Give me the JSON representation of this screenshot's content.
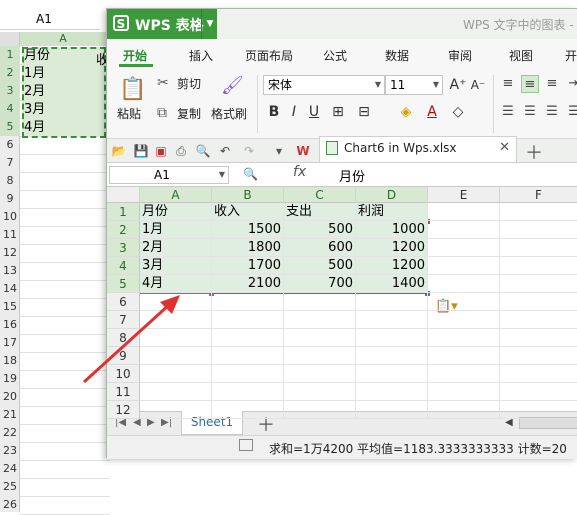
{
  "background_sheet": {
    "namebox": "A1",
    "col_header": "A",
    "row_numbers": [
      "1",
      "2",
      "3",
      "4",
      "5",
      "6",
      "7",
      "8",
      "9",
      "10",
      "11",
      "12",
      "13",
      "14",
      "15",
      "16",
      "17",
      "18",
      "19",
      "20",
      "21",
      "22",
      "23",
      "24",
      "25",
      "26"
    ],
    "cells": [
      "月份",
      "1月",
      "2月",
      "3月",
      "4月"
    ],
    "col_b_fragment": "收"
  },
  "window": {
    "app_name": "WPS 表格",
    "title": "WPS 文字中的图表 -",
    "tabs": [
      "开始",
      "插入",
      "页面布局",
      "公式",
      "数据",
      "审阅",
      "视图",
      "开"
    ],
    "active_tab": "开始",
    "clipboard": {
      "paste": "粘贴",
      "cut": "剪切",
      "copy": "复制",
      "format_painter": "格式刷"
    },
    "font": {
      "name": "宋体",
      "size": "11"
    },
    "format_buttons": [
      "B",
      "I",
      "U"
    ],
    "document_tab": "Chart6 in Wps.xlsx",
    "formula_bar": {
      "cell_ref": "A1",
      "fx": "fx",
      "value": "月份"
    },
    "columns": [
      "A",
      "B",
      "C",
      "D",
      "E",
      "F"
    ],
    "rows": [
      "1",
      "2",
      "3",
      "4",
      "5",
      "6",
      "7",
      "8",
      "9",
      "10",
      "11",
      "12"
    ],
    "table": {
      "headers": [
        "月份",
        "收入",
        "支出",
        "利润"
      ],
      "rows": [
        [
          "1月",
          "1500",
          "500",
          "1000"
        ],
        [
          "2月",
          "1800",
          "600",
          "1200"
        ],
        [
          "3月",
          "1700",
          "500",
          "1200"
        ],
        [
          "4月",
          "2100",
          "700",
          "1400"
        ]
      ]
    },
    "sheet_tab": "Sheet1",
    "status": "求和=1万4200   平均值=1183.3333333333   计数=20"
  },
  "colors": {
    "accent": "#3c9a3c",
    "selection": "#dfeee0",
    "arrow": "#e03030"
  }
}
